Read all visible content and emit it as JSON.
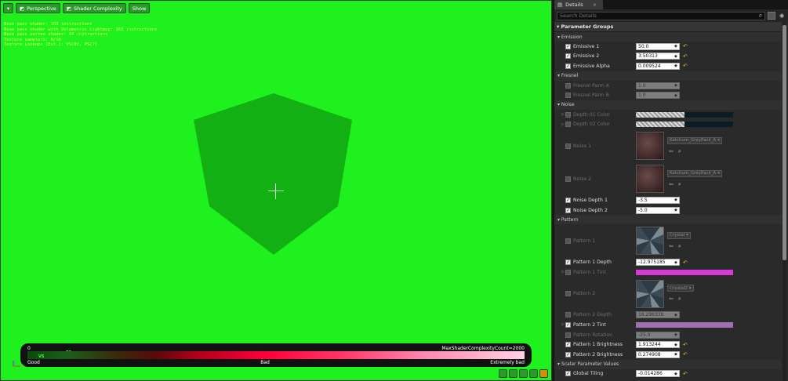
{
  "viewport": {
    "toolbar": {
      "perspective": "Perspective",
      "view_mode": "Shader Complexity",
      "show": "Show"
    },
    "stats": [
      "Base pass shader: 153 instructions",
      "Base pass shader with Volumetric Lightmap: 163 instructions",
      "Base pass vertex shader: 44 instructions",
      "Texture samplers: 8/16",
      "Texture Lookups (Est.): VS(0), PS(7)"
    ],
    "legend": {
      "min_value": "0",
      "max_label": "MaxShaderComplexityCount=2000",
      "good": "Good",
      "bad": "Bad",
      "extremely_bad": "Extremely bad",
      "vs_marker": "VS",
      "ps_marker": "PS"
    },
    "colors": {
      "background": "#1ef11e",
      "cube": "#12b012"
    }
  },
  "details": {
    "tab_label": "Details",
    "search_placeholder": "Search Details",
    "parameter_groups": "Parameter Groups",
    "groups": {
      "emission": "Emission",
      "fresnel": "Fresnel",
      "noise": "Noise",
      "pattern": "Pattern",
      "scalar": "Scalar Parameter Values"
    },
    "emission": [
      {
        "label": "Emissive 1",
        "value": "50.0"
      },
      {
        "label": "Emissive 2",
        "value": "3.50313"
      },
      {
        "label": "Emissive Alpha",
        "value": "0.009524"
      }
    ],
    "fresnel": [
      {
        "label": "Fresnel Parm A",
        "value": "1.0"
      },
      {
        "label": "Fresnel Parm B",
        "value": "1.0"
      }
    ],
    "noise": {
      "depth01": "Depth 01 Color",
      "depth02": "Depth 02 Color",
      "noise1": {
        "label": "Noise 1",
        "texture": "Ketchum_GreyPack_A"
      },
      "noise2": {
        "label": "Noise 2",
        "texture": "Ketchum_GreyPack_A"
      },
      "noise_depth1": {
        "label": "Noise Depth 1",
        "value": "-3.5"
      },
      "noise_depth2": {
        "label": "Noise Depth 2",
        "value": "-5.0"
      }
    },
    "pattern": {
      "pattern1": {
        "label": "Pattern 1",
        "texture": "Crystal"
      },
      "pattern1_depth": {
        "label": "Pattern 1 Depth",
        "value": "-12.975185"
      },
      "pattern1_tint": {
        "label": "Pattern 1 Tint",
        "color": "#d63ad6"
      },
      "pattern2": {
        "label": "Pattern 2",
        "texture": "Crystal2"
      },
      "pattern2_depth": {
        "label": "Pattern 2 Depth",
        "value": "16.296339"
      },
      "pattern2_tint": {
        "label": "Pattern 2 Tint",
        "color": "#a070b0"
      },
      "pattern_rotation": {
        "label": "Pattern Rotation",
        "value": "-25.0"
      },
      "pattern1_brightness": {
        "label": "Pattern 1 Brightness",
        "value": "1.913244"
      },
      "pattern2_brightness": {
        "label": "Pattern 2 Brightness",
        "value": "0.274908"
      }
    },
    "scalar": {
      "global_tiling": {
        "label": "Global Tiling",
        "value": "-0.014286"
      }
    }
  }
}
